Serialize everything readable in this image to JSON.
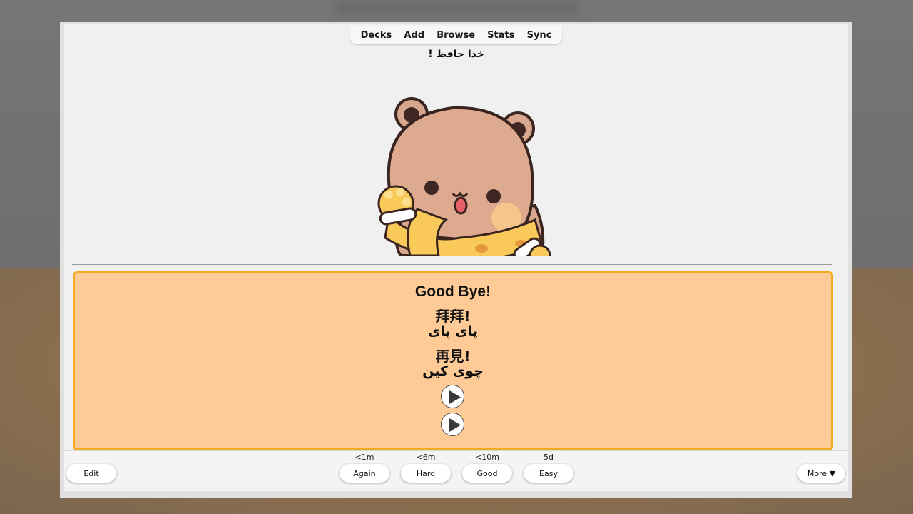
{
  "toolbar": {
    "items": [
      "Decks",
      "Add",
      "Browse",
      "Stats",
      "Sync"
    ]
  },
  "card": {
    "question": "خدا حافظ !",
    "answer_lines": [
      "Good Bye!",
      "拜拜!",
      "پای پای",
      "再見!",
      "چوی کین"
    ],
    "audio_buttons": [
      "play-icon",
      "play-icon"
    ],
    "image": "bear-waving-with-scarf"
  },
  "bottom": {
    "edit_label": "Edit",
    "more_label": "More ▼",
    "answers": [
      {
        "label": "Again",
        "interval": "<1m"
      },
      {
        "label": "Hard",
        "interval": "<6m"
      },
      {
        "label": "Good",
        "interval": "<10m"
      },
      {
        "label": "Easy",
        "interval": "5d"
      }
    ]
  },
  "colors": {
    "answer_bg": "#fecb97",
    "answer_border": "#f2ab23",
    "window_bg": "#f0f0f0"
  }
}
